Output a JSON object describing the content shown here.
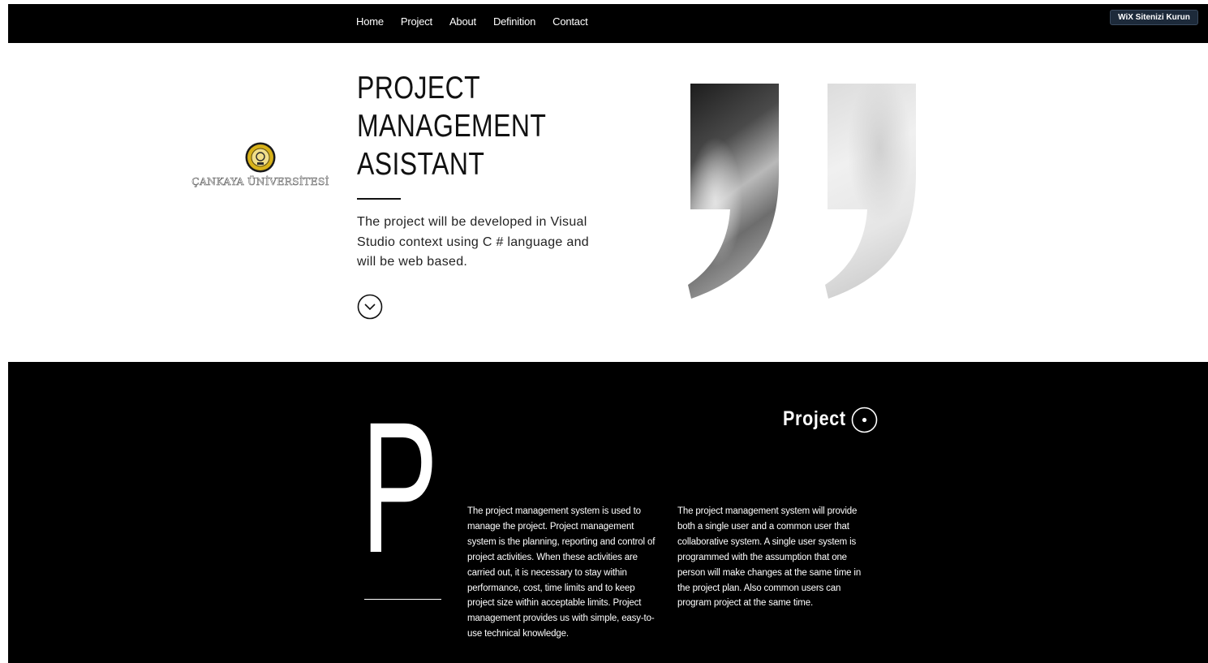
{
  "nav": {
    "items": [
      "Home",
      "Project",
      "About",
      "Definition",
      "Contact"
    ]
  },
  "wix_badge": "WiX Sitenizi Kurun",
  "logo": {
    "text": "ÇANKAYA ÜNİVERSİTESİ"
  },
  "hero": {
    "title": "PROJECT\nMANAGEMENT\nASISTANT",
    "description": "The project will be developed in Visual Studio context using C # language and will be web based.",
    "scroll_icon": "chevron-down-circle-icon"
  },
  "project_section": {
    "big_letter": "P",
    "title": "Project",
    "col1": "The project management system is used to manage the project. Project management system is the planning, reporting and control of project activities. When these activities are carried out, it is necessary to stay within performance, cost, time limits and to keep project size within acceptable limits. Project management provides us with simple, easy-to-use technical knowledge.",
    "col2": "The project management system will provide both a single user and a common user that collaborative system. A single user system is programmed with the assumption that one person will make changes at the same time in the project plan. Also common users can program project at the same time."
  },
  "colors": {
    "nav_bg": "#000000",
    "section_bg": "#000000",
    "badge_bg": "#1d2a3a",
    "seal_gold": "#d8b21a"
  }
}
